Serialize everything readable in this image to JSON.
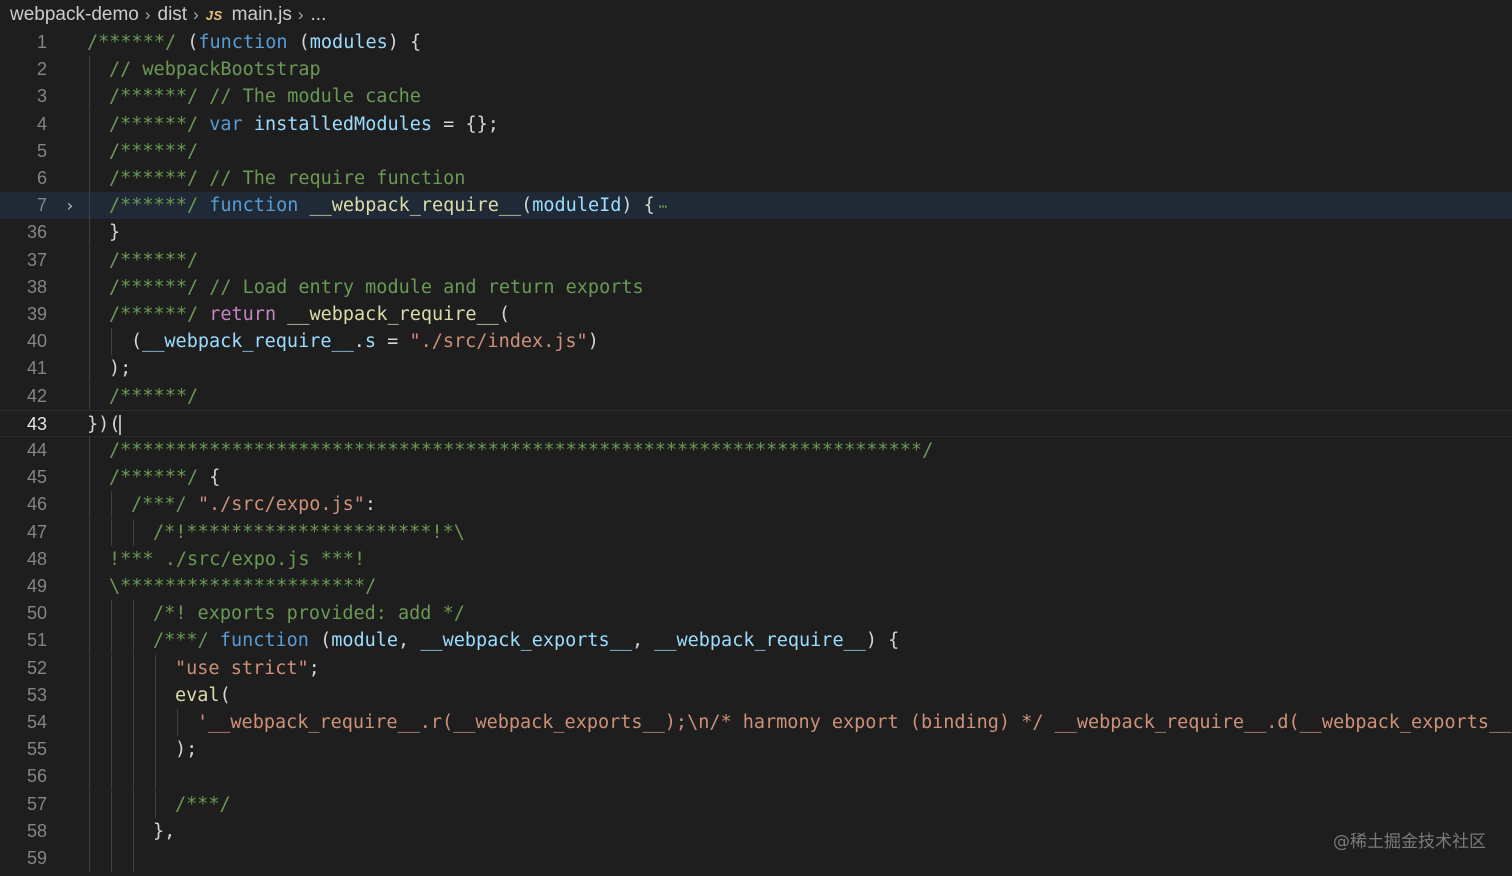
{
  "breadcrumb": {
    "project": "webpack-demo",
    "folder": "dist",
    "file_icon": "JS",
    "file": "main.js",
    "more": "..."
  },
  "editor": {
    "folded_ellipsis": "⋯",
    "lines": [
      {
        "n": "1",
        "indent": 0,
        "tokens": [
          [
            "com",
            "/******/ "
          ],
          [
            "p",
            "("
          ],
          [
            "kw",
            "function"
          ],
          [
            "p",
            " ("
          ],
          [
            "var",
            "modules"
          ],
          [
            "p",
            ") {"
          ]
        ]
      },
      {
        "n": "2",
        "indent": 1,
        "tokens": [
          [
            "com",
            "// webpackBootstrap"
          ]
        ]
      },
      {
        "n": "3",
        "indent": 1,
        "tokens": [
          [
            "com",
            "/******/ // The module cache"
          ]
        ]
      },
      {
        "n": "4",
        "indent": 1,
        "tokens": [
          [
            "com",
            "/******/ "
          ],
          [
            "kw",
            "var"
          ],
          [
            "p",
            " "
          ],
          [
            "var",
            "installedModules"
          ],
          [
            "p",
            " = {};"
          ]
        ]
      },
      {
        "n": "5",
        "indent": 1,
        "tokens": [
          [
            "com",
            "/******/"
          ]
        ]
      },
      {
        "n": "6",
        "indent": 1,
        "tokens": [
          [
            "com",
            "/******/ // The require function"
          ]
        ]
      },
      {
        "n": "7",
        "indent": 1,
        "fold": true,
        "current": true,
        "tokens": [
          [
            "com",
            "/******/ "
          ],
          [
            "kw",
            "function"
          ],
          [
            "p",
            " "
          ],
          [
            "fn",
            "__webpack_require__"
          ],
          [
            "p",
            "("
          ],
          [
            "var",
            "moduleId"
          ],
          [
            "p",
            ") {"
          ]
        ]
      },
      {
        "n": "36",
        "indent": 1,
        "tokens": [
          [
            "p",
            "}"
          ]
        ]
      },
      {
        "n": "37",
        "indent": 1,
        "tokens": [
          [
            "com",
            "/******/"
          ]
        ]
      },
      {
        "n": "38",
        "indent": 1,
        "tokens": [
          [
            "com",
            "/******/ // Load entry module and return exports"
          ]
        ]
      },
      {
        "n": "39",
        "indent": 1,
        "tokens": [
          [
            "com",
            "/******/ "
          ],
          [
            "ctl",
            "return"
          ],
          [
            "p",
            " "
          ],
          [
            "fn",
            "__webpack_require__"
          ],
          [
            "p",
            "("
          ]
        ]
      },
      {
        "n": "40",
        "indent": 2,
        "tokens": [
          [
            "p",
            "("
          ],
          [
            "var",
            "__webpack_require__"
          ],
          [
            "p",
            "."
          ],
          [
            "var",
            "s"
          ],
          [
            "p",
            " = "
          ],
          [
            "str",
            "\"./src/index.js\""
          ],
          [
            "p",
            ")"
          ]
        ]
      },
      {
        "n": "41",
        "indent": 1,
        "tokens": [
          [
            "p",
            ");"
          ]
        ]
      },
      {
        "n": "42",
        "indent": 1,
        "tokens": [
          [
            "com",
            "/******/"
          ]
        ]
      },
      {
        "n": "43",
        "indent": 0,
        "active": true,
        "cursor": true,
        "tokens": [
          [
            "p",
            "})("
          ]
        ]
      },
      {
        "n": "44",
        "indent": 1,
        "tokens": [
          [
            "com",
            "/************************************************************************/"
          ]
        ]
      },
      {
        "n": "45",
        "indent": 1,
        "tokens": [
          [
            "com",
            "/******/ "
          ],
          [
            "p",
            "{"
          ]
        ]
      },
      {
        "n": "46",
        "indent": 2,
        "tokens": [
          [
            "com",
            "/***/ "
          ],
          [
            "str",
            "\"./src/expo.js\""
          ],
          [
            "p",
            ":"
          ]
        ]
      },
      {
        "n": "47",
        "indent": 3,
        "tokens": [
          [
            "com",
            "/*!**********************!*\\"
          ]
        ]
      },
      {
        "n": "48",
        "indent": 1,
        "tokens": [
          [
            "com",
            "!*** ./src/expo.js ***!"
          ]
        ]
      },
      {
        "n": "49",
        "indent": 1,
        "tokens": [
          [
            "com",
            "\\**********************/"
          ]
        ]
      },
      {
        "n": "50",
        "indent": 3,
        "tokens": [
          [
            "com",
            "/*! exports provided: add */"
          ]
        ]
      },
      {
        "n": "51",
        "indent": 3,
        "tokens": [
          [
            "com",
            "/***/ "
          ],
          [
            "kw",
            "function"
          ],
          [
            "p",
            " ("
          ],
          [
            "var",
            "module"
          ],
          [
            "p",
            ", "
          ],
          [
            "var",
            "__webpack_exports__"
          ],
          [
            "p",
            ", "
          ],
          [
            "var",
            "__webpack_require__"
          ],
          [
            "p",
            ") {"
          ]
        ]
      },
      {
        "n": "52",
        "indent": 4,
        "tokens": [
          [
            "str",
            "\"use strict\""
          ],
          [
            "p",
            ";"
          ]
        ]
      },
      {
        "n": "53",
        "indent": 4,
        "tokens": [
          [
            "fn",
            "eval"
          ],
          [
            "p",
            "("
          ]
        ]
      },
      {
        "n": "54",
        "indent": 5,
        "tokens": [
          [
            "str",
            "'__webpack_require__.r(__webpack_exports__);\\n/* harmony export (binding) */ __webpack_require__.d(__webpack_exports__, 'a"
          ]
        ]
      },
      {
        "n": "55",
        "indent": 4,
        "tokens": [
          [
            "p",
            ");"
          ]
        ]
      },
      {
        "n": "56",
        "indent": 4,
        "tokens": []
      },
      {
        "n": "57",
        "indent": 4,
        "tokens": [
          [
            "com",
            "/***/"
          ]
        ]
      },
      {
        "n": "58",
        "indent": 3,
        "tokens": [
          [
            "p",
            "},"
          ]
        ]
      },
      {
        "n": "59",
        "indent": 3,
        "tokens": []
      }
    ]
  },
  "watermark": "@稀土掘金技术社区",
  "colors": {
    "background": "#1e1e1e",
    "comment": "#6a9955",
    "keyword": "#569cd6",
    "control": "#c586c0",
    "function": "#dcdcaa",
    "variable": "#9cdcfe",
    "string": "#ce9178"
  }
}
